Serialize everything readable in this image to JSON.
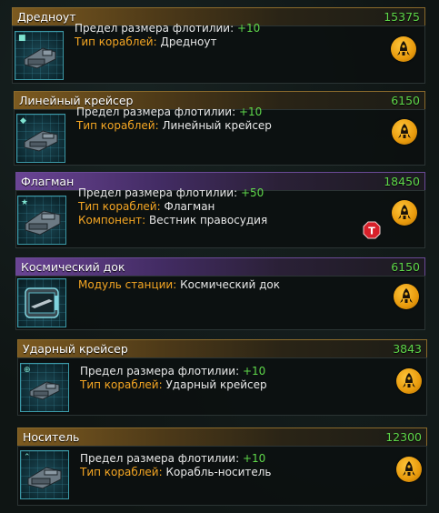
{
  "cards": [
    {
      "name": "Дредноут",
      "cost": "15375",
      "corner_icon": "square",
      "line1_label": "Предел размера флотилии:",
      "line1_value": "+10",
      "line2_key": "Тип кораблей:",
      "line2_value": "Дредноут"
    },
    {
      "name": "Линейный крейсер",
      "cost": "6150",
      "corner_icon": "diamond",
      "line1_label": "Предел размера флотилии:",
      "line1_value": "+10",
      "line2_key": "Тип кораблей:",
      "line2_value": "Линейный крейсер"
    },
    {
      "name": "Флагман",
      "cost": "18450",
      "corner_icon": "star",
      "line1_label": "Предел размера флотилии:",
      "line1_value": "+50",
      "line2_key": "Тип кораблей:",
      "line2_value": "Флагман",
      "line3_key": "Компонент:",
      "line3_value": "Вестник правосудия",
      "badge_letter": "T"
    },
    {
      "name": "Космический док",
      "cost": "6150",
      "line1_key": "Модуль станции:",
      "line1_value": "Космический док"
    },
    {
      "name": "Ударный крейсер",
      "cost": "3843",
      "corner_icon": "crosshair",
      "line1_label": "Предел размера флотилии:",
      "line1_value": "+10",
      "line2_key": "Тип кораблей:",
      "line2_value": "Ударный крейсер"
    },
    {
      "name": "Носитель",
      "cost": "12300",
      "corner_icon": "chevron",
      "line1_label": "Предел размера флотилии:",
      "line1_value": "+10",
      "line2_key": "Тип кораблей:",
      "line2_value": "Корабль-носитель"
    }
  ],
  "colors": {
    "cost_green": "#5fd84a",
    "key_orange": "#f5a623",
    "header_gold": "#7c5a20",
    "header_purple": "#6a4494",
    "rocket_orange": "#e89a0c",
    "badge_red": "#d8202a"
  }
}
